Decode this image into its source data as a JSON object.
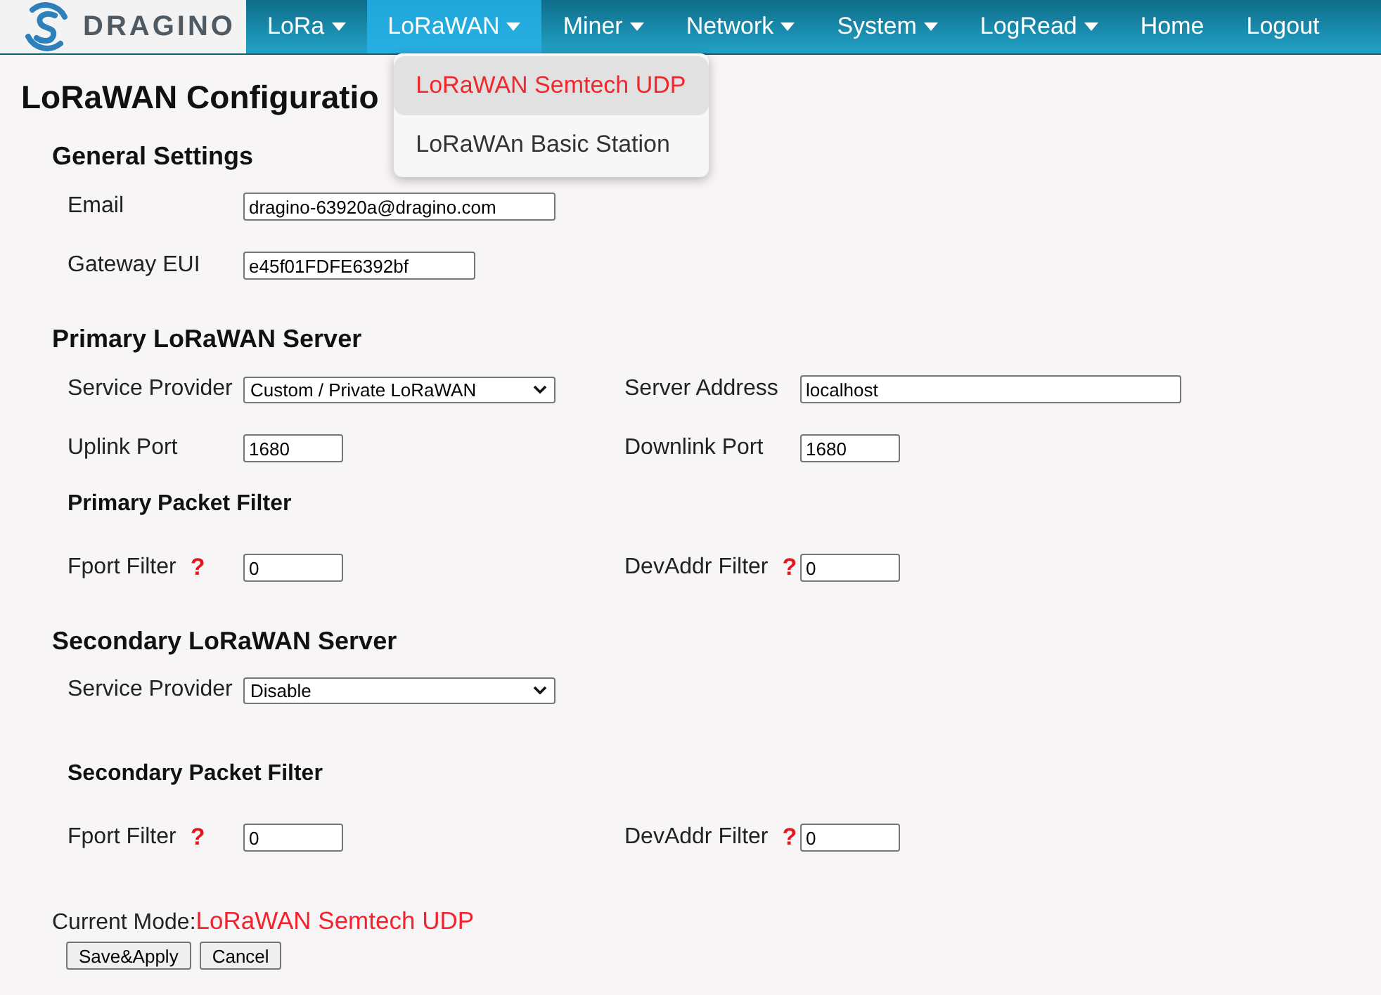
{
  "header": {
    "logo_text": "DRAGINO",
    "nav_items": [
      {
        "label": "LoRa",
        "has_menu": true,
        "selected": false
      },
      {
        "label": "LoRaWAN",
        "has_menu": true,
        "selected": true,
        "menu": [
          {
            "label": "LoRaWAN Semtech UDP",
            "selected": true
          },
          {
            "label": "LoRaWAn Basic Station",
            "selected": false
          }
        ]
      },
      {
        "label": "Miner",
        "has_menu": true,
        "selected": false
      },
      {
        "label": "Network",
        "has_menu": true,
        "selected": false
      },
      {
        "label": "System",
        "has_menu": true,
        "selected": false
      },
      {
        "label": "LogRead",
        "has_menu": true,
        "selected": false
      },
      {
        "label": "Home",
        "has_menu": false,
        "selected": false
      },
      {
        "label": "Logout",
        "has_menu": false,
        "selected": false
      }
    ]
  },
  "title": "LoRaWAN Configuratio",
  "sections": [
    {
      "heading": "General Settings",
      "rows": [
        [
          {
            "kind": "email",
            "label": "Email",
            "value": "dragino-63920a@dragino.com"
          }
        ],
        [
          {
            "kind": "eui",
            "label": "Gateway EUI",
            "value": "e45f01FDFE6392bf"
          }
        ]
      ]
    },
    {
      "heading": "Primary LoRaWAN Server",
      "rows": [
        [
          {
            "kind": "select",
            "label": "Service Provider",
            "value": "Custom / Private LoRaWAN"
          },
          {
            "kind": "address",
            "label": "Server Address",
            "value": "localhost"
          }
        ],
        [
          {
            "kind": "port",
            "label": "Uplink Port",
            "value": "1680"
          },
          {
            "kind": "port",
            "label": "Downlink Port",
            "value": "1680"
          }
        ]
      ],
      "filter": {
        "heading": "Primary Packet Filter",
        "rows": [
          [
            {
              "kind": "port",
              "label": "Fport Filter",
              "help": "?",
              "value": "0"
            },
            {
              "kind": "port",
              "label": "DevAddr Filter",
              "help": "?",
              "value": "0"
            }
          ]
        ]
      }
    },
    {
      "heading": "Secondary LoRaWAN Server",
      "rows": [
        [
          {
            "kind": "select",
            "label": "Service Provider",
            "value": "Disable"
          }
        ]
      ],
      "filter": {
        "heading": "Secondary Packet Filter",
        "rows": [
          [
            {
              "kind": "port",
              "label": "Fport Filter",
              "help": "?",
              "value": "0"
            },
            {
              "kind": "port",
              "label": "DevAddr Filter",
              "help": "?",
              "value": "0"
            }
          ]
        ]
      }
    }
  ],
  "current_mode": {
    "label": "Current Mode:",
    "value": "LoRaWAN Semtech UDP"
  },
  "buttons": [
    "Save&Apply",
    "Cancel"
  ]
}
